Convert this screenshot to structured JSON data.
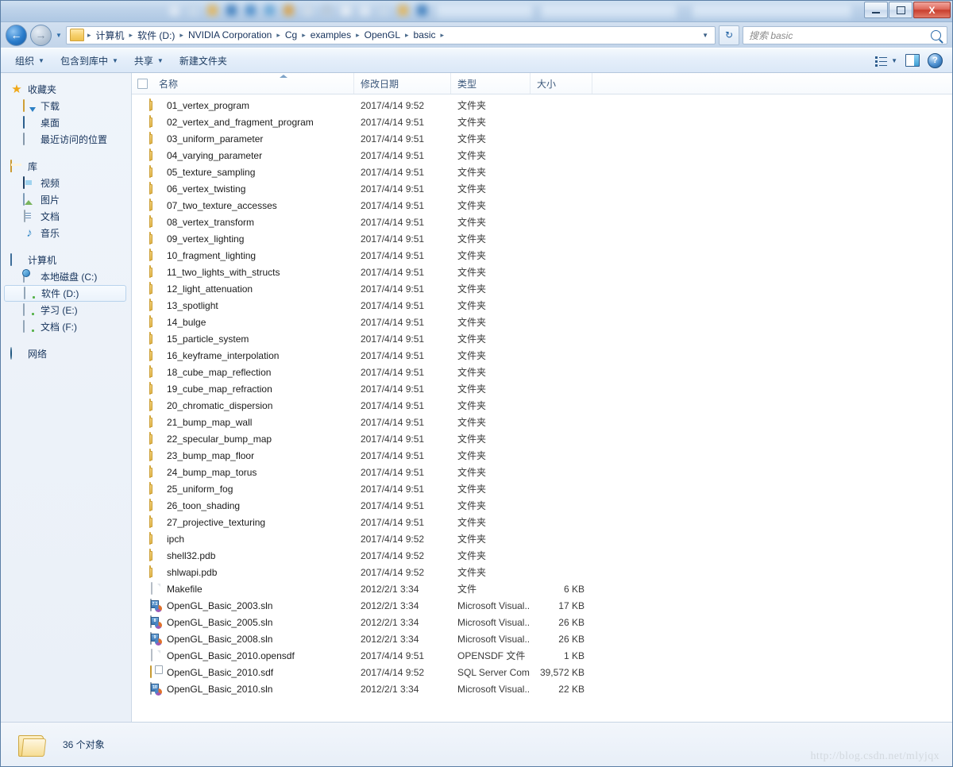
{
  "window": {
    "controls": {
      "minimize": "—",
      "maximize": "□",
      "close": "X"
    }
  },
  "nav": {
    "back_glyph": "←",
    "forward_glyph": "→",
    "history_glyph": "▼",
    "crumb_dropdown_glyph": "▼",
    "refresh_glyph": "↻",
    "breadcrumb": [
      "计算机",
      "软件 (D:)",
      "NVIDIA Corporation",
      "Cg",
      "examples",
      "OpenGL",
      "basic"
    ],
    "separator": "▸"
  },
  "search": {
    "placeholder": "搜索 basic"
  },
  "toolbar": {
    "items": [
      {
        "label": "组织",
        "has_caret": true
      },
      {
        "label": "包含到库中",
        "has_caret": true
      },
      {
        "label": "共享",
        "has_caret": true
      },
      {
        "label": "新建文件夹",
        "has_caret": false
      }
    ],
    "view_caret": "▼",
    "help_label": "?"
  },
  "sidebar": {
    "groups": [
      {
        "header": {
          "label": "收藏夹",
          "icon": "star-icon"
        },
        "items": [
          {
            "label": "下载",
            "icon": "download-icon"
          },
          {
            "label": "桌面",
            "icon": "desktop-icon"
          },
          {
            "label": "最近访问的位置",
            "icon": "recent-places-icon"
          }
        ]
      },
      {
        "header": {
          "label": "库",
          "icon": "library-icon"
        },
        "items": [
          {
            "label": "视频",
            "icon": "video-icon"
          },
          {
            "label": "图片",
            "icon": "pictures-icon"
          },
          {
            "label": "文档",
            "icon": "documents-icon"
          },
          {
            "label": "音乐",
            "icon": "music-icon"
          }
        ]
      },
      {
        "header": {
          "label": "计算机",
          "icon": "computer-icon"
        },
        "items": [
          {
            "label": "本地磁盘 (C:)",
            "icon": "system-drive-icon",
            "selected": false
          },
          {
            "label": "软件 (D:)",
            "icon": "drive-icon",
            "selected": true
          },
          {
            "label": "学习 (E:)",
            "icon": "drive-icon",
            "selected": false
          },
          {
            "label": "文档 (F:)",
            "icon": "drive-icon",
            "selected": false
          }
        ]
      },
      {
        "header": {
          "label": "网络",
          "icon": "network-icon"
        },
        "items": []
      }
    ]
  },
  "filelist": {
    "columns": {
      "name": "名称",
      "date": "修改日期",
      "type": "类型",
      "size": "大小"
    },
    "sort_column": "名称",
    "sort_direction": "ascending",
    "rows": [
      {
        "name": "01_vertex_program",
        "date": "2017/4/14 9:52",
        "type": "文件夹",
        "size": "",
        "icon": "folder-icon"
      },
      {
        "name": "02_vertex_and_fragment_program",
        "date": "2017/4/14 9:51",
        "type": "文件夹",
        "size": "",
        "icon": "folder-icon"
      },
      {
        "name": "03_uniform_parameter",
        "date": "2017/4/14 9:51",
        "type": "文件夹",
        "size": "",
        "icon": "folder-icon"
      },
      {
        "name": "04_varying_parameter",
        "date": "2017/4/14 9:51",
        "type": "文件夹",
        "size": "",
        "icon": "folder-icon"
      },
      {
        "name": "05_texture_sampling",
        "date": "2017/4/14 9:51",
        "type": "文件夹",
        "size": "",
        "icon": "folder-icon"
      },
      {
        "name": "06_vertex_twisting",
        "date": "2017/4/14 9:51",
        "type": "文件夹",
        "size": "",
        "icon": "folder-icon"
      },
      {
        "name": "07_two_texture_accesses",
        "date": "2017/4/14 9:51",
        "type": "文件夹",
        "size": "",
        "icon": "folder-icon"
      },
      {
        "name": "08_vertex_transform",
        "date": "2017/4/14 9:51",
        "type": "文件夹",
        "size": "",
        "icon": "folder-icon"
      },
      {
        "name": "09_vertex_lighting",
        "date": "2017/4/14 9:51",
        "type": "文件夹",
        "size": "",
        "icon": "folder-icon"
      },
      {
        "name": "10_fragment_lighting",
        "date": "2017/4/14 9:51",
        "type": "文件夹",
        "size": "",
        "icon": "folder-icon"
      },
      {
        "name": "11_two_lights_with_structs",
        "date": "2017/4/14 9:51",
        "type": "文件夹",
        "size": "",
        "icon": "folder-icon"
      },
      {
        "name": "12_light_attenuation",
        "date": "2017/4/14 9:51",
        "type": "文件夹",
        "size": "",
        "icon": "folder-icon"
      },
      {
        "name": "13_spotlight",
        "date": "2017/4/14 9:51",
        "type": "文件夹",
        "size": "",
        "icon": "folder-icon"
      },
      {
        "name": "14_bulge",
        "date": "2017/4/14 9:51",
        "type": "文件夹",
        "size": "",
        "icon": "folder-icon"
      },
      {
        "name": "15_particle_system",
        "date": "2017/4/14 9:51",
        "type": "文件夹",
        "size": "",
        "icon": "folder-icon"
      },
      {
        "name": "16_keyframe_interpolation",
        "date": "2017/4/14 9:51",
        "type": "文件夹",
        "size": "",
        "icon": "folder-icon"
      },
      {
        "name": "18_cube_map_reflection",
        "date": "2017/4/14 9:51",
        "type": "文件夹",
        "size": "",
        "icon": "folder-icon"
      },
      {
        "name": "19_cube_map_refraction",
        "date": "2017/4/14 9:51",
        "type": "文件夹",
        "size": "",
        "icon": "folder-icon"
      },
      {
        "name": "20_chromatic_dispersion",
        "date": "2017/4/14 9:51",
        "type": "文件夹",
        "size": "",
        "icon": "folder-icon"
      },
      {
        "name": "21_bump_map_wall",
        "date": "2017/4/14 9:51",
        "type": "文件夹",
        "size": "",
        "icon": "folder-icon"
      },
      {
        "name": "22_specular_bump_map",
        "date": "2017/4/14 9:51",
        "type": "文件夹",
        "size": "",
        "icon": "folder-icon"
      },
      {
        "name": "23_bump_map_floor",
        "date": "2017/4/14 9:51",
        "type": "文件夹",
        "size": "",
        "icon": "folder-icon"
      },
      {
        "name": "24_bump_map_torus",
        "date": "2017/4/14 9:51",
        "type": "文件夹",
        "size": "",
        "icon": "folder-icon"
      },
      {
        "name": "25_uniform_fog",
        "date": "2017/4/14 9:51",
        "type": "文件夹",
        "size": "",
        "icon": "folder-icon"
      },
      {
        "name": "26_toon_shading",
        "date": "2017/4/14 9:51",
        "type": "文件夹",
        "size": "",
        "icon": "folder-icon"
      },
      {
        "name": "27_projective_texturing",
        "date": "2017/4/14 9:51",
        "type": "文件夹",
        "size": "",
        "icon": "folder-icon"
      },
      {
        "name": "ipch",
        "date": "2017/4/14 9:52",
        "type": "文件夹",
        "size": "",
        "icon": "folder-icon"
      },
      {
        "name": "shell32.pdb",
        "date": "2017/4/14 9:52",
        "type": "文件夹",
        "size": "",
        "icon": "folder-icon"
      },
      {
        "name": "shlwapi.pdb",
        "date": "2017/4/14 9:52",
        "type": "文件夹",
        "size": "",
        "icon": "folder-icon"
      },
      {
        "name": "Makefile",
        "date": "2012/2/1 3:34",
        "type": "文件",
        "size": "6 KB",
        "icon": "generic-file-icon"
      },
      {
        "name": "OpenGL_Basic_2003.sln",
        "date": "2012/2/1 3:34",
        "type": "Microsoft Visual...",
        "size": "17 KB",
        "icon": "visual-studio-solution-icon",
        "badge": "7.1"
      },
      {
        "name": "OpenGL_Basic_2005.sln",
        "date": "2012/2/1 3:34",
        "type": "Microsoft Visual...",
        "size": "26 KB",
        "icon": "visual-studio-solution-icon",
        "badge": "8"
      },
      {
        "name": "OpenGL_Basic_2008.sln",
        "date": "2012/2/1 3:34",
        "type": "Microsoft Visual...",
        "size": "26 KB",
        "icon": "visual-studio-solution-icon",
        "badge": "9"
      },
      {
        "name": "OpenGL_Basic_2010.opensdf",
        "date": "2017/4/14 9:51",
        "type": "OPENSDF 文件",
        "size": "1 KB",
        "icon": "generic-file-icon"
      },
      {
        "name": "OpenGL_Basic_2010.sdf",
        "date": "2017/4/14 9:52",
        "type": "SQL Server Com...",
        "size": "39,572 KB",
        "icon": "sql-server-file-icon"
      },
      {
        "name": "OpenGL_Basic_2010.sln",
        "date": "2012/2/1 3:34",
        "type": "Microsoft Visual...",
        "size": "22 KB",
        "icon": "visual-studio-solution-icon",
        "badge": "10"
      }
    ]
  },
  "status": {
    "count_text": "36 个对象"
  },
  "watermark": {
    "text": "http://blog.csdn.net/mlyjqx"
  },
  "colors": {
    "accent": "#2b6cab",
    "close_button": "#c83f2e",
    "folder_yellow": "#f2c95f",
    "text": "#1b1b1b",
    "header_text": "#3b577a"
  }
}
